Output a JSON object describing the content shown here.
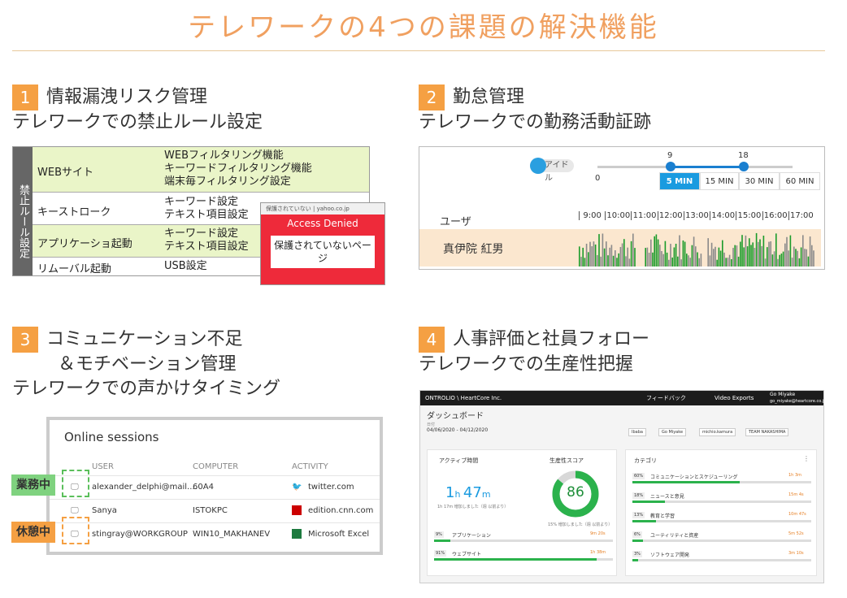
{
  "title": "テレワークの4つの課題の解決機能",
  "sections": [
    {
      "num": "1",
      "head": "情報漏洩リスク管理",
      "sub": "テレワークでの禁止ルール設定"
    },
    {
      "num": "2",
      "head": "勤怠管理",
      "sub": "テレワークでの勤務活動証跡"
    },
    {
      "num": "3",
      "head": "コミュニケーション不足",
      "head2": "＆モチベーション管理",
      "sub": "テレワークでの声かけタイミング"
    },
    {
      "num": "4",
      "head": "人事評価と社員フォロー",
      "sub": "テレワークでの生産性把握"
    }
  ],
  "rules": {
    "side_label": "禁止ルール設定",
    "rows": [
      {
        "name": "WEBサイト",
        "settings": [
          "WEBフィルタリング機能",
          "キーワードフィルタリング機能",
          "端末毎フィルタリング設定"
        ]
      },
      {
        "name": "キーストローク",
        "settings": [
          "キーワード設定",
          "テキスト項目設定"
        ]
      },
      {
        "name": "アプリケーショ起動",
        "settings": [
          "キーワード設定",
          "テキスト項目設定"
        ]
      },
      {
        "name": "リムーバル起動",
        "settings": [
          "USB設定"
        ]
      }
    ],
    "denied": {
      "url": "保護されていない | yahoo.co.jp",
      "title": "Access Denied",
      "message": "保護されていないページ"
    }
  },
  "attendance": {
    "idle_label": "アイドル",
    "slider_min": "0",
    "slider_a": "9",
    "slider_b": "18",
    "zoom": [
      "5 MIN",
      "15 MIN",
      "30 MIN",
      "60 MIN"
    ],
    "zoom_selected": "5 MIN",
    "user_header": "ユーザ",
    "hours": [
      "9:00",
      "10:00",
      "11:00",
      "12:00",
      "13:00",
      "14:00",
      "15:00",
      "16:00",
      "17:00"
    ],
    "user_name": "真伊院 紅男"
  },
  "sessions": {
    "title": "Online sessions",
    "columns": [
      "USER",
      "COMPUTER",
      "ACTIVITY"
    ],
    "rows": [
      {
        "user": "alexander_delphi@mail....",
        "computer": "60A4",
        "activity": "twitter.com",
        "tag": "業務中"
      },
      {
        "user": "Sanya",
        "computer": "ISTOKPC",
        "activity": "edition.cnn.com",
        "tag": ""
      },
      {
        "user": "stingray@WORKGROUP",
        "computer": "WIN10_MAKHANEV",
        "activity": "Microsoft Excel",
        "tag": "休憩中"
      }
    ]
  },
  "dashboard": {
    "brand": "ONTROLIO \\ HeartCore Inc.",
    "feedback": "フィードバック",
    "video_exports": "Video Exports",
    "user_name": "Go Miyake",
    "user_email": "go_miyake@heartcore.co.jp",
    "page_title": "ダッシュボード",
    "date_label": "日付",
    "date_range": "04/06/2020 - 04/12/2020",
    "filters": [
      "Ibaba",
      "Go Miyake",
      "michio.kamura",
      "TEAM NAKASHIMA"
    ],
    "active_time_label": "アクティブ時間",
    "active_h": "1",
    "active_m": "47",
    "active_note": "1h 17m 増加しました（週 以前より）",
    "productivity_label": "生産性スコア",
    "score": "86",
    "score_note": "15% 増加しました（週 以前より）",
    "activities": [
      {
        "pct": "9%",
        "name": "アプリケーション",
        "time": "9m 20s"
      },
      {
        "pct": "91%",
        "name": "ウェブサイト",
        "time": "1h 38m"
      }
    ],
    "category_label": "カテゴリ",
    "categories": [
      {
        "pct": "60%",
        "name": "コミュニケーションとスケジューリング",
        "time": "1h 3m"
      },
      {
        "pct": "18%",
        "name": "ニュースと意見",
        "time": "15m 4s"
      },
      {
        "pct": "13%",
        "name": "教育と学習",
        "time": "10m 47s"
      },
      {
        "pct": "6%",
        "name": "ユーティリティと資産",
        "time": "5m 52s"
      },
      {
        "pct": "3%",
        "name": "ソフトウェア開発",
        "time": "3m 10s"
      }
    ]
  },
  "colors": {
    "accent": "#f5a043",
    "title": "#f0a060",
    "green": "#2bb24c",
    "blue": "#1a9be0",
    "red": "#ee2a3a"
  }
}
